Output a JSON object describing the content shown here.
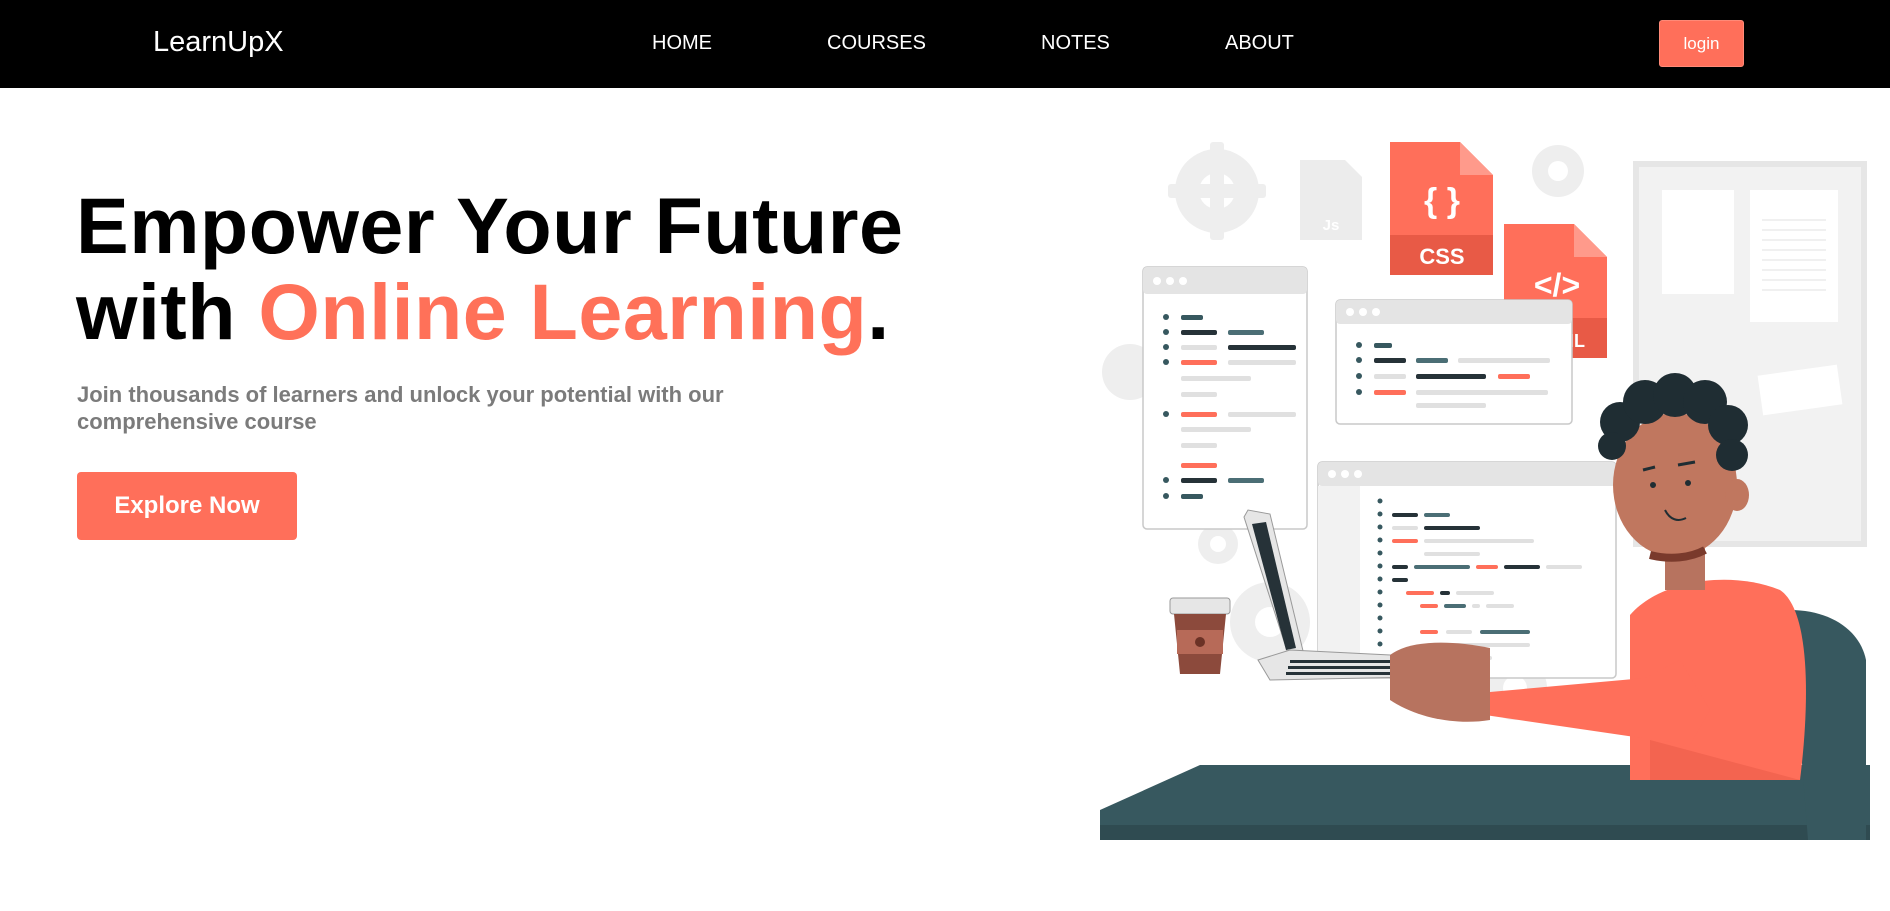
{
  "nav": {
    "brand": "LearnUpX",
    "links": [
      "HOME",
      "COURSES",
      "NOTES",
      "ABOUT"
    ],
    "login_label": "login"
  },
  "hero": {
    "title_line1": "Empower Your Future",
    "title_line2_prefix": "with ",
    "title_highlight": "Online Learning",
    "title_suffix": ".",
    "subtitle": "Join thousands of learners and unlock your potential with our comprehensive course",
    "cta_label": "Explore Now"
  },
  "illustration": {
    "file_labels": [
      "Js",
      "CSS",
      "{ }",
      "</>",
      "ML"
    ]
  },
  "colors": {
    "accent": "#ff6f5a",
    "navbar": "#000000",
    "text_muted": "#7b7b7b",
    "dark_teal": "#37585f"
  }
}
